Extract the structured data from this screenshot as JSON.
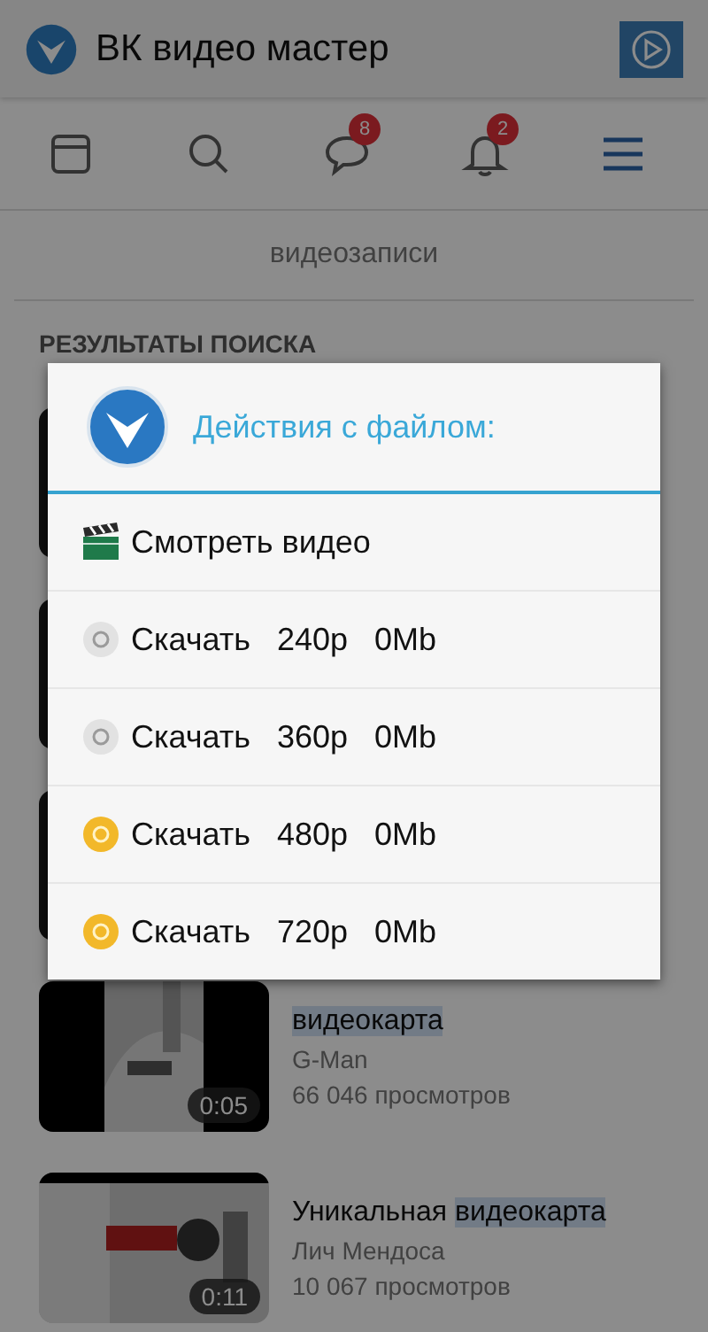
{
  "app_bar": {
    "title": "ВК видео мастер"
  },
  "nav": [
    {
      "kind": "window",
      "selected": false
    },
    {
      "kind": "search",
      "selected": false
    },
    {
      "kind": "chat",
      "selected": false,
      "badge": "8"
    },
    {
      "kind": "bell",
      "selected": false,
      "badge": "2"
    },
    {
      "kind": "menu",
      "selected": true
    }
  ],
  "notice": "видеозаписи",
  "section_title": "РЕЗУЛЬТАТЫ ПОИСКА",
  "videos": [
    {
      "title": [
        {
          "text": "видеокарта",
          "highlight": true
        }
      ],
      "author": "G-Man",
      "views": "66 046 просмотров",
      "duration": "0:05"
    },
    {
      "title": [
        {
          "text": "Уникальная ",
          "highlight": false
        },
        {
          "text": "видеокарта",
          "highlight": true
        }
      ],
      "author": "Лич Мендоса",
      "views": "10 067 просмотров",
      "duration": "0:11"
    }
  ],
  "dialog": {
    "title": "Действия с файлом:",
    "items": [
      {
        "kind": "watch",
        "label": "Смотреть видео"
      },
      {
        "kind": "download",
        "label": "Скачать",
        "quality": "240p",
        "size": "0Mb",
        "available": false
      },
      {
        "kind": "download",
        "label": "Скачать",
        "quality": "360p",
        "size": "0Mb",
        "available": false
      },
      {
        "kind": "download",
        "label": "Скачать",
        "quality": "480p",
        "size": "0Mb",
        "available": true
      },
      {
        "kind": "download",
        "label": "Скачать",
        "quality": "720p",
        "size": "0Mb",
        "available": true
      }
    ]
  }
}
